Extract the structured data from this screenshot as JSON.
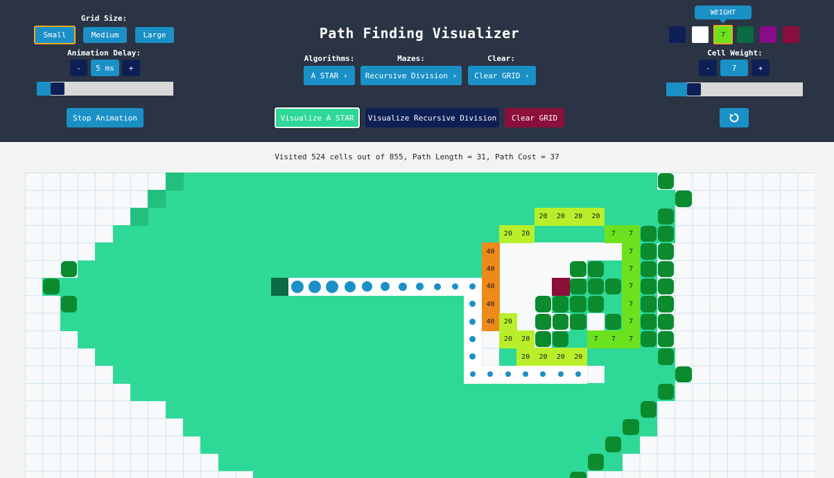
{
  "header": {
    "title": "Path Finding Visualizer",
    "grid_size_label": "Grid Size:",
    "grid_sizes": [
      "Small",
      "Medium",
      "Large"
    ],
    "selected_grid_size": "Small",
    "animation_delay_label": "Animation Delay:",
    "delay_minus": "-",
    "delay_value": "5 ms",
    "delay_plus": "+",
    "delay_level": 0.1,
    "stop_label": "Stop Animation",
    "algorithms_label": "Algorithms:",
    "algorithm_value": "A STAR ›",
    "mazes_label": "Mazes:",
    "maze_value": "Recursive Division ›",
    "clear_label": "Clear:",
    "clear_value": "Clear GRID ›",
    "visualize_algo": "Visualize A STAR",
    "visualize_maze": "Visualize Recursive Division",
    "clear_grid": "Clear GRID",
    "weight_tooltip": "WEIGHT",
    "swatches": [
      {
        "color": "#0d1f55",
        "name": "start"
      },
      {
        "color": "#ffffff",
        "name": "empty"
      },
      {
        "color": "#6ce21f",
        "name": "weight",
        "label": "7"
      },
      {
        "color": "#0a6b44",
        "name": "wall"
      },
      {
        "color": "#8a0a8a",
        "name": "purple"
      },
      {
        "color": "#8a0f3a",
        "name": "target"
      }
    ],
    "cell_weight_label": "Cell Weight:",
    "weight_minus": "-",
    "weight_value": "7",
    "weight_plus": "+",
    "weight_level": 0.15,
    "reset_icon": "refresh-icon"
  },
  "stats": {
    "text": "Visited 524 cells out of 855, Path Length = 31, Path Cost = 37"
  },
  "colors": {
    "visited": "#2ed897",
    "visited_edge": "#22c07e",
    "wall": "#0b8a2e",
    "wall_dark": "#0b7a2a",
    "path": "#1a90c7",
    "weight7": "#6ce21f",
    "weight20": "#b8ef2a",
    "weight40": "#ee8a1c",
    "start": "#0a6b44",
    "target": "#8a0f3a"
  },
  "grid": {
    "weights": [
      {
        "r": 2,
        "c": 29,
        "w": "20"
      },
      {
        "r": 2,
        "c": 30,
        "w": "20"
      },
      {
        "r": 2,
        "c": 31,
        "w": "20"
      },
      {
        "r": 2,
        "c": 32,
        "w": "20"
      },
      {
        "r": 3,
        "c": 27,
        "w": "20"
      },
      {
        "r": 3,
        "c": 28,
        "w": "20"
      },
      {
        "r": 3,
        "c": 33,
        "w": "7"
      },
      {
        "r": 3,
        "c": 34,
        "w": "7"
      },
      {
        "r": 4,
        "c": 26,
        "w": "40"
      },
      {
        "r": 4,
        "c": 34,
        "w": "7"
      },
      {
        "r": 5,
        "c": 26,
        "w": "40"
      },
      {
        "r": 5,
        "c": 34,
        "w": "7"
      },
      {
        "r": 6,
        "c": 26,
        "w": "40"
      },
      {
        "r": 6,
        "c": 34,
        "w": "7"
      },
      {
        "r": 7,
        "c": 26,
        "w": "40"
      },
      {
        "r": 7,
        "c": 34,
        "w": "7"
      },
      {
        "r": 8,
        "c": 26,
        "w": "40"
      },
      {
        "r": 8,
        "c": 27,
        "w": "20"
      },
      {
        "r": 8,
        "c": 34,
        "w": "7"
      },
      {
        "r": 9,
        "c": 27,
        "w": "20"
      },
      {
        "r": 9,
        "c": 28,
        "w": "20"
      },
      {
        "r": 9,
        "c": 32,
        "w": "7"
      },
      {
        "r": 9,
        "c": 33,
        "w": "7"
      },
      {
        "r": 9,
        "c": 34,
        "w": "7"
      },
      {
        "r": 10,
        "c": 28,
        "w": "20"
      },
      {
        "r": 10,
        "c": 29,
        "w": "20"
      },
      {
        "r": 10,
        "c": 30,
        "w": "20"
      },
      {
        "r": 10,
        "c": 31,
        "w": "20"
      }
    ]
  }
}
